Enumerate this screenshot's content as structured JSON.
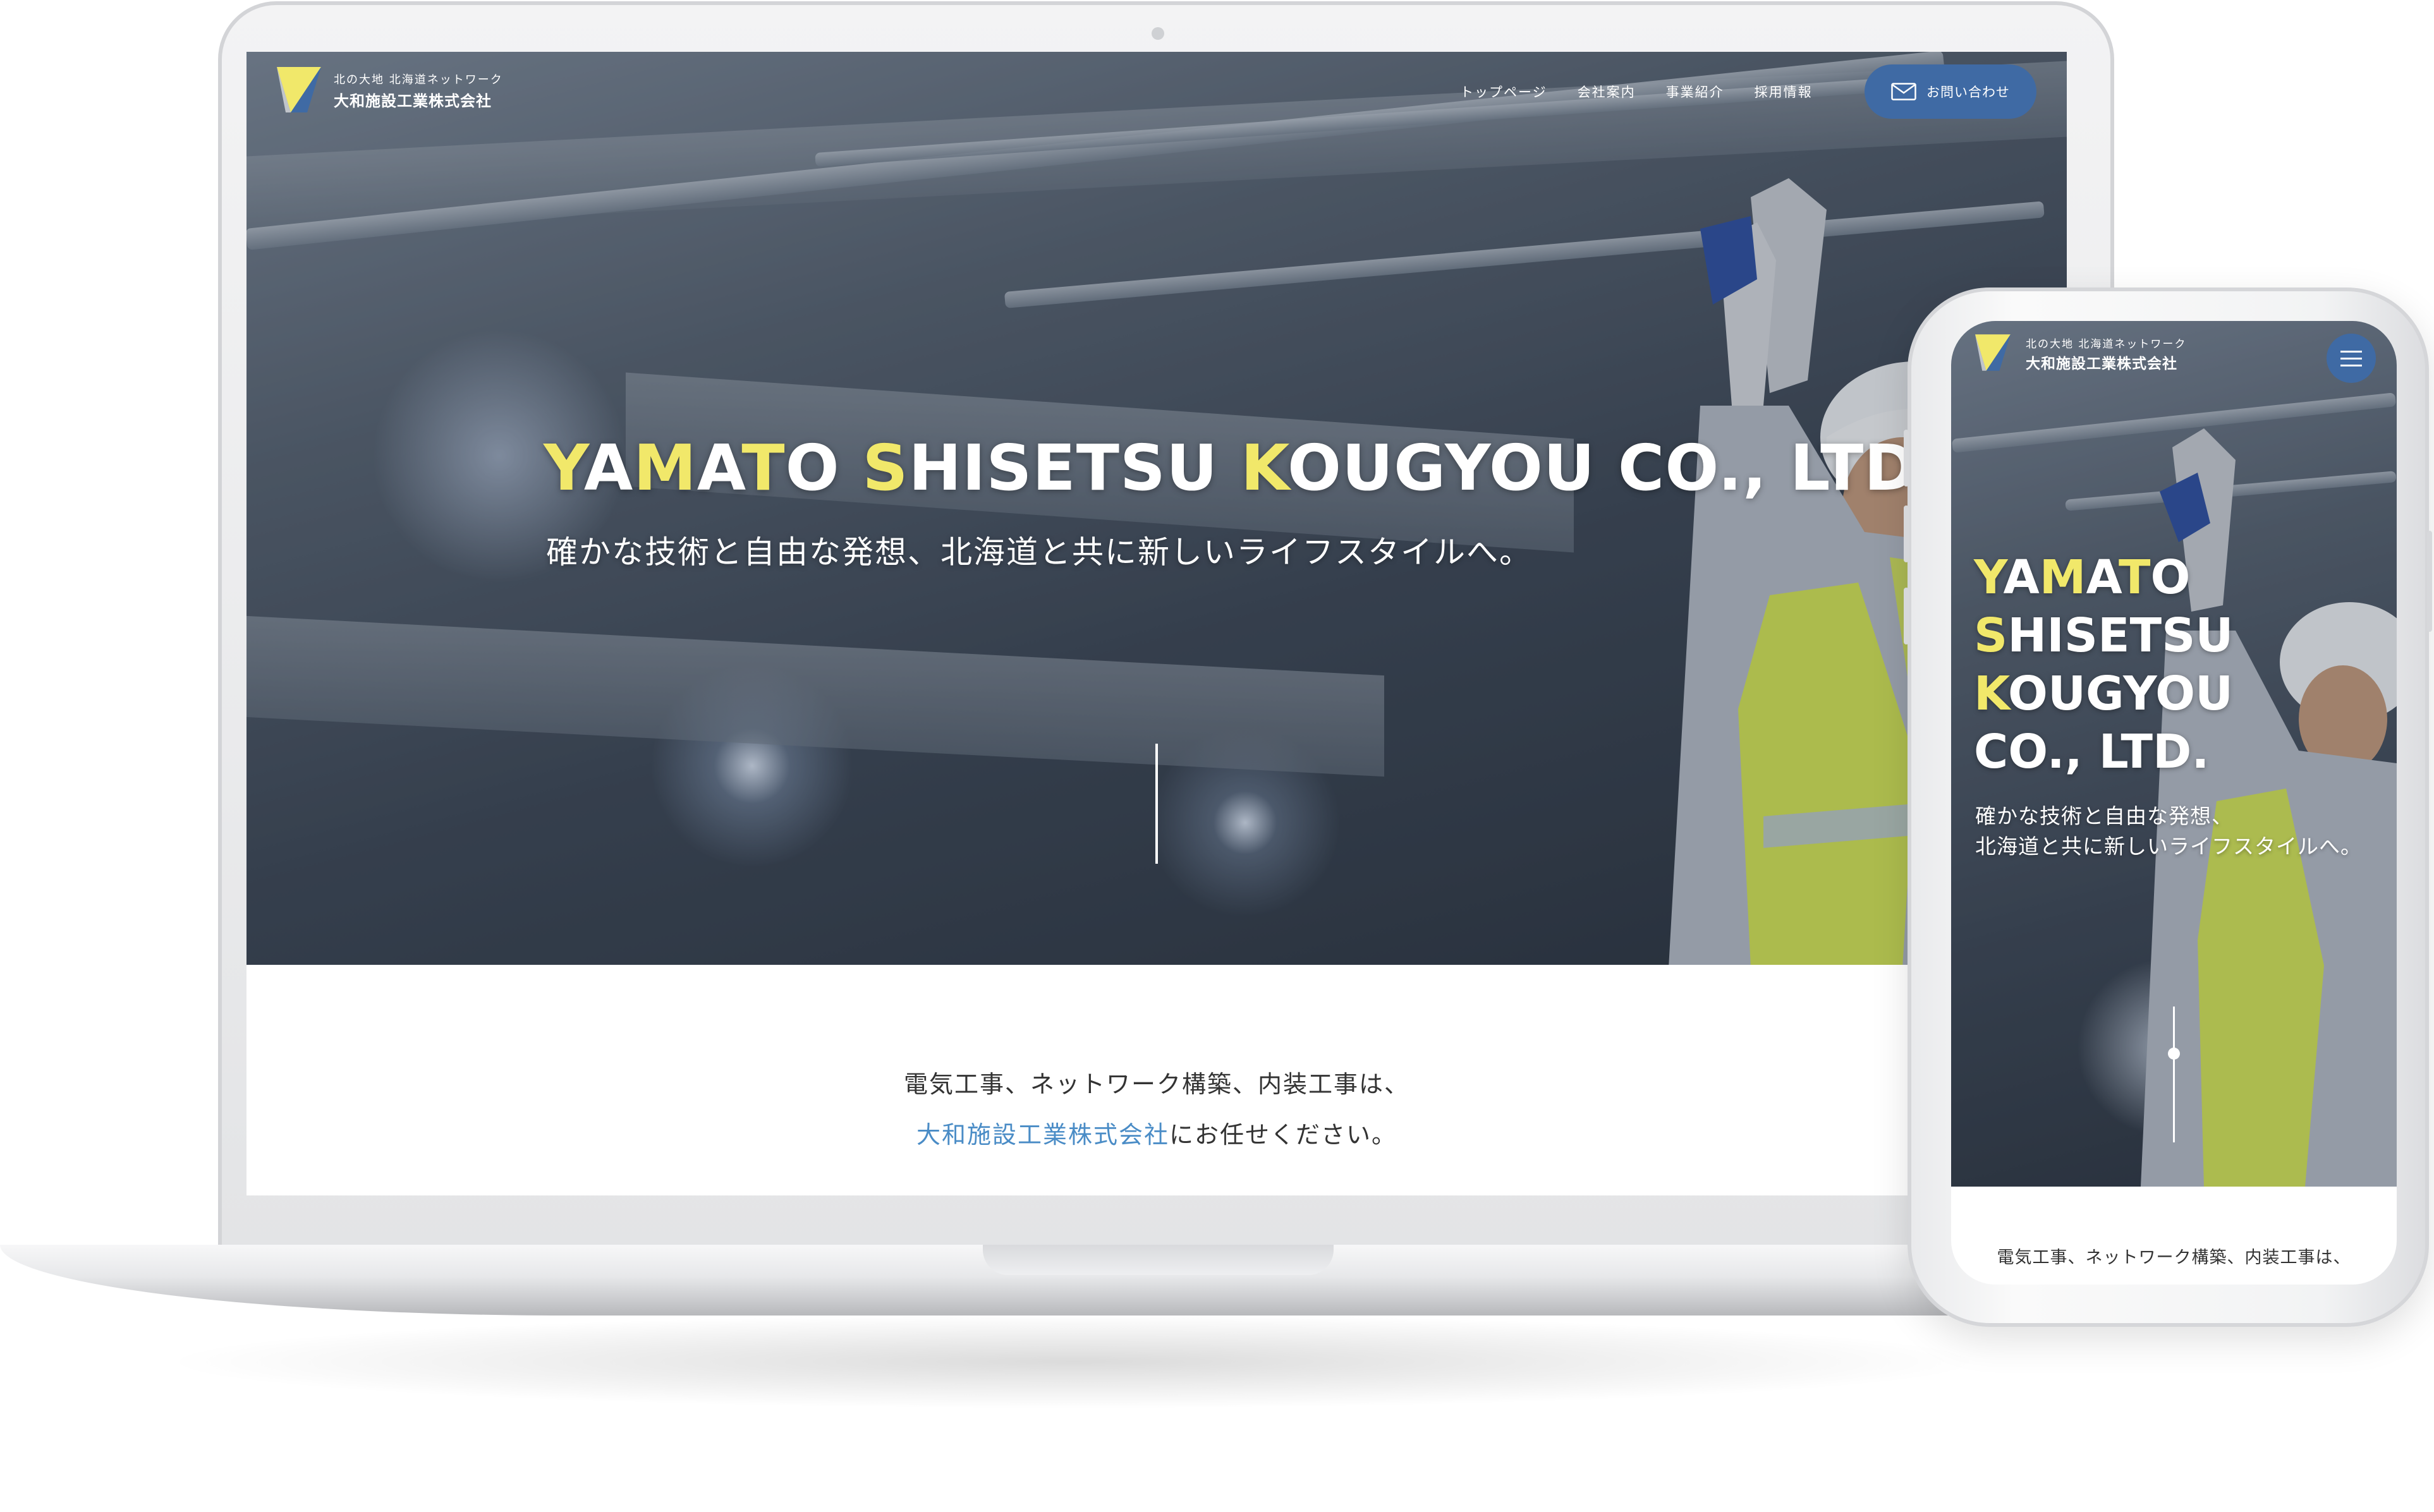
{
  "colors": {
    "accent_blue": "#3f6aa4",
    "highlight_yellow": "#f1e86a",
    "link_blue": "#4a8cc6",
    "body_text": "#333333"
  },
  "brand": {
    "tagline": "北の大地 北海道ネットワーク",
    "company_name": "大和施設工業株式会社",
    "logo_icon": "yamato-logo-icon"
  },
  "desktop": {
    "nav": {
      "items": [
        {
          "label": "トップページ"
        },
        {
          "label": "会社案内"
        },
        {
          "label": "事業紹介"
        },
        {
          "label": "採用情報"
        }
      ],
      "contact_label": "お問い合わせ",
      "contact_icon": "mail-icon"
    },
    "hero": {
      "title_parts": [
        {
          "text": "Y",
          "highlight": true
        },
        {
          "text": "A",
          "highlight": false
        },
        {
          "text": "M",
          "highlight": true
        },
        {
          "text": "A",
          "highlight": false
        },
        {
          "text": "T",
          "highlight": true
        },
        {
          "text": "O ",
          "highlight": false
        },
        {
          "text": "S",
          "highlight": true
        },
        {
          "text": "HISETSU ",
          "highlight": false
        },
        {
          "text": "K",
          "highlight": true
        },
        {
          "text": "OUGYOU CO., LTD.",
          "highlight": false
        }
      ],
      "subtitle": "確かな技術と自由な発想、北海道と共に新しいライフスタイルへ。"
    },
    "intro": {
      "line1": "電気工事、ネットワーク構築、内装工事は、",
      "line2_link": "大和施設工業株式会社",
      "line2_rest": "にお任せください。"
    }
  },
  "mobile": {
    "menu_icon": "hamburger-menu-icon",
    "hero": {
      "lines": [
        {
          "parts": [
            {
              "text": "Y",
              "highlight": true
            },
            {
              "text": "A",
              "highlight": false
            },
            {
              "text": "M",
              "highlight": true
            },
            {
              "text": "A",
              "highlight": false
            },
            {
              "text": "T",
              "highlight": true
            },
            {
              "text": "O",
              "highlight": false
            }
          ]
        },
        {
          "parts": [
            {
              "text": "S",
              "highlight": true
            },
            {
              "text": "HISETSU",
              "highlight": false
            }
          ]
        },
        {
          "parts": [
            {
              "text": "K",
              "highlight": true
            },
            {
              "text": "OUGYOU",
              "highlight": false
            }
          ]
        },
        {
          "parts": [
            {
              "text": "CO., LTD.",
              "highlight": false
            }
          ]
        }
      ],
      "subtitle_line1": "確かな技術と自由な発想、",
      "subtitle_line2": "北海道と共に新しいライフスタイルへ。"
    },
    "intro_line1": "電気工事、ネットワーク構築、内装工事は、"
  }
}
